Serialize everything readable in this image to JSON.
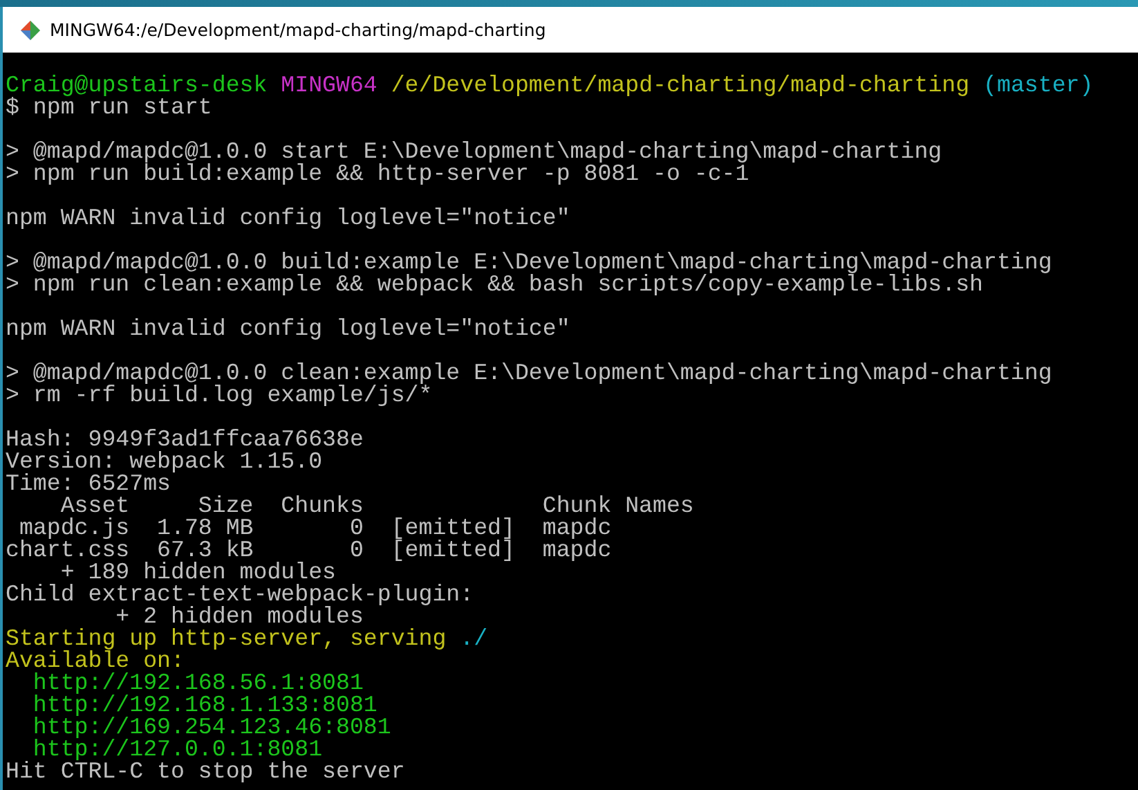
{
  "window": {
    "title": "MINGW64:/e/Development/mapd-charting/mapd-charting"
  },
  "terminal_blocks": [
    [
      [
        {
          "text": "Craig@upstairs-desk ",
          "color": "#1cc51c"
        },
        {
          "text": "MINGW64 ",
          "color": "#c832c8"
        },
        {
          "text": "/e/Development/mapd-charting/mapd-charting ",
          "color": "#c3c31d"
        },
        {
          "text": "(master)",
          "color": "#19b1c4"
        }
      ],
      [
        {
          "text": "$ npm run start",
          "color": "#c0c0c0"
        }
      ]
    ],
    [
      [
        {
          "text": "> @mapd/mapdc@1.0.0 start E:\\Development\\mapd-charting\\mapd-charting",
          "color": "#c0c0c0"
        }
      ],
      [
        {
          "text": "> npm run build:example && http-server -p 8081 -o -c-1",
          "color": "#c0c0c0"
        }
      ]
    ],
    [
      [
        {
          "text": "npm WARN invalid config loglevel=\"notice\"",
          "color": "#c0c0c0"
        }
      ]
    ],
    [
      [
        {
          "text": "> @mapd/mapdc@1.0.0 build:example E:\\Development\\mapd-charting\\mapd-charting",
          "color": "#c0c0c0"
        }
      ],
      [
        {
          "text": "> npm run clean:example && webpack && bash scripts/copy-example-libs.sh",
          "color": "#c0c0c0"
        }
      ]
    ],
    [
      [
        {
          "text": "npm WARN invalid config loglevel=\"notice\"",
          "color": "#c0c0c0"
        }
      ]
    ],
    [
      [
        {
          "text": "> @mapd/mapdc@1.0.0 clean:example E:\\Development\\mapd-charting\\mapd-charting",
          "color": "#c0c0c0"
        }
      ],
      [
        {
          "text": "> rm -rf build.log example/js/*",
          "color": "#c0c0c0"
        }
      ]
    ],
    [
      [
        {
          "text": "Hash: 9949f3ad1ffcaa76638e",
          "color": "#c0c0c0"
        }
      ],
      [
        {
          "text": "Version: webpack 1.15.0",
          "color": "#c0c0c0"
        }
      ],
      [
        {
          "text": "Time: 6527ms",
          "color": "#c0c0c0"
        }
      ],
      [
        {
          "text": "    Asset     Size  Chunks             Chunk Names",
          "color": "#c0c0c0"
        }
      ],
      [
        {
          "text": " mapdc.js  1.78 MB       0  [emitted]  mapdc",
          "color": "#c0c0c0"
        }
      ],
      [
        {
          "text": "chart.css  67.3 kB       0  [emitted]  mapdc",
          "color": "#c0c0c0"
        }
      ],
      [
        {
          "text": "    + 189 hidden modules",
          "color": "#c0c0c0"
        }
      ],
      [
        {
          "text": "Child extract-text-webpack-plugin:",
          "color": "#c0c0c0"
        }
      ],
      [
        {
          "text": "        + 2 hidden modules",
          "color": "#c0c0c0"
        }
      ],
      [
        {
          "text": "Starting up http-server, serving ",
          "color": "#c3c31d"
        },
        {
          "text": "./",
          "color": "#19b1c4"
        }
      ],
      [
        {
          "text": "Available on:",
          "color": "#c3c31d"
        }
      ],
      [
        {
          "text": "  http://192.168.56.1:8081",
          "color": "#1cc51c"
        }
      ],
      [
        {
          "text": "  http://192.168.1.133:8081",
          "color": "#1cc51c"
        }
      ],
      [
        {
          "text": "  http://169.254.123.46:8081",
          "color": "#1cc51c"
        }
      ],
      [
        {
          "text": "  http://127.0.0.1:8081",
          "color": "#1cc51c"
        }
      ],
      [
        {
          "text": "Hit CTRL-C to stop the server",
          "color": "#c0c0c0"
        }
      ]
    ]
  ]
}
